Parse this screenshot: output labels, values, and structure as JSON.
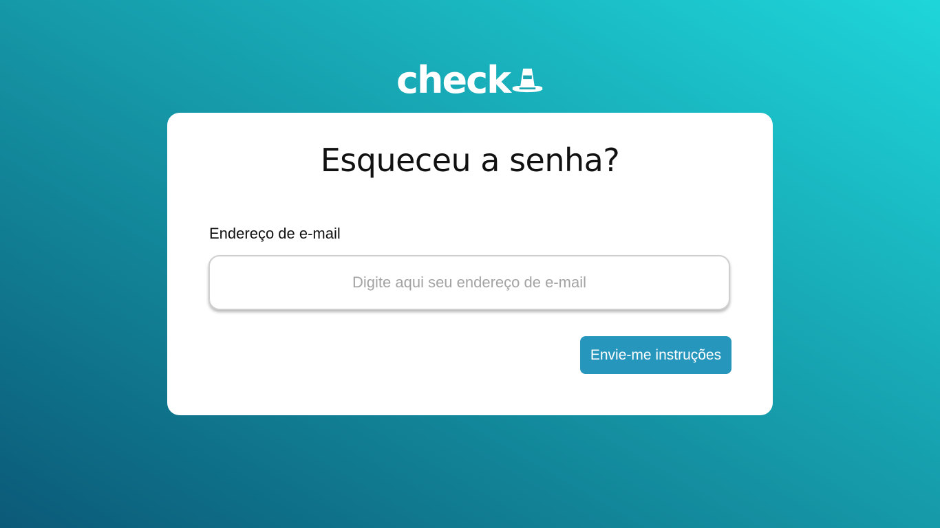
{
  "brand": {
    "logo_text": "check",
    "icon": "traffic-cone-icon",
    "logo_color": "#ffffff"
  },
  "form": {
    "title": "Esqueceu a senha?",
    "email_label": "Endereço de e-mail",
    "email_value": "",
    "email_placeholder": "Digite aqui seu endereço de e-mail",
    "submit_label": "Envie-me instruções"
  },
  "colors": {
    "background_start": "#0b5a78",
    "background_end": "#1ed6da",
    "card": "#ffffff",
    "button": "#2796bd",
    "button_text": "#ffffff"
  }
}
